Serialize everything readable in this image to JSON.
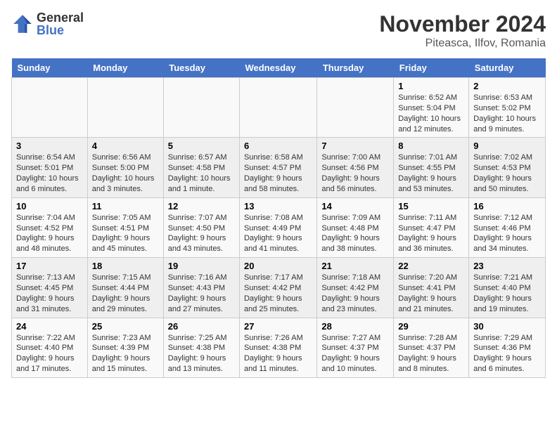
{
  "header": {
    "logo_general": "General",
    "logo_blue": "Blue",
    "month_title": "November 2024",
    "location": "Piteasca, Ilfov, Romania"
  },
  "weekdays": [
    "Sunday",
    "Monday",
    "Tuesday",
    "Wednesday",
    "Thursday",
    "Friday",
    "Saturday"
  ],
  "weeks": [
    [
      {
        "day": "",
        "info": ""
      },
      {
        "day": "",
        "info": ""
      },
      {
        "day": "",
        "info": ""
      },
      {
        "day": "",
        "info": ""
      },
      {
        "day": "",
        "info": ""
      },
      {
        "day": "1",
        "info": "Sunrise: 6:52 AM\nSunset: 5:04 PM\nDaylight: 10 hours and 12 minutes."
      },
      {
        "day": "2",
        "info": "Sunrise: 6:53 AM\nSunset: 5:02 PM\nDaylight: 10 hours and 9 minutes."
      }
    ],
    [
      {
        "day": "3",
        "info": "Sunrise: 6:54 AM\nSunset: 5:01 PM\nDaylight: 10 hours and 6 minutes."
      },
      {
        "day": "4",
        "info": "Sunrise: 6:56 AM\nSunset: 5:00 PM\nDaylight: 10 hours and 3 minutes."
      },
      {
        "day": "5",
        "info": "Sunrise: 6:57 AM\nSunset: 4:58 PM\nDaylight: 10 hours and 1 minute."
      },
      {
        "day": "6",
        "info": "Sunrise: 6:58 AM\nSunset: 4:57 PM\nDaylight: 9 hours and 58 minutes."
      },
      {
        "day": "7",
        "info": "Sunrise: 7:00 AM\nSunset: 4:56 PM\nDaylight: 9 hours and 56 minutes."
      },
      {
        "day": "8",
        "info": "Sunrise: 7:01 AM\nSunset: 4:55 PM\nDaylight: 9 hours and 53 minutes."
      },
      {
        "day": "9",
        "info": "Sunrise: 7:02 AM\nSunset: 4:53 PM\nDaylight: 9 hours and 50 minutes."
      }
    ],
    [
      {
        "day": "10",
        "info": "Sunrise: 7:04 AM\nSunset: 4:52 PM\nDaylight: 9 hours and 48 minutes."
      },
      {
        "day": "11",
        "info": "Sunrise: 7:05 AM\nSunset: 4:51 PM\nDaylight: 9 hours and 45 minutes."
      },
      {
        "day": "12",
        "info": "Sunrise: 7:07 AM\nSunset: 4:50 PM\nDaylight: 9 hours and 43 minutes."
      },
      {
        "day": "13",
        "info": "Sunrise: 7:08 AM\nSunset: 4:49 PM\nDaylight: 9 hours and 41 minutes."
      },
      {
        "day": "14",
        "info": "Sunrise: 7:09 AM\nSunset: 4:48 PM\nDaylight: 9 hours and 38 minutes."
      },
      {
        "day": "15",
        "info": "Sunrise: 7:11 AM\nSunset: 4:47 PM\nDaylight: 9 hours and 36 minutes."
      },
      {
        "day": "16",
        "info": "Sunrise: 7:12 AM\nSunset: 4:46 PM\nDaylight: 9 hours and 34 minutes."
      }
    ],
    [
      {
        "day": "17",
        "info": "Sunrise: 7:13 AM\nSunset: 4:45 PM\nDaylight: 9 hours and 31 minutes."
      },
      {
        "day": "18",
        "info": "Sunrise: 7:15 AM\nSunset: 4:44 PM\nDaylight: 9 hours and 29 minutes."
      },
      {
        "day": "19",
        "info": "Sunrise: 7:16 AM\nSunset: 4:43 PM\nDaylight: 9 hours and 27 minutes."
      },
      {
        "day": "20",
        "info": "Sunrise: 7:17 AM\nSunset: 4:42 PM\nDaylight: 9 hours and 25 minutes."
      },
      {
        "day": "21",
        "info": "Sunrise: 7:18 AM\nSunset: 4:42 PM\nDaylight: 9 hours and 23 minutes."
      },
      {
        "day": "22",
        "info": "Sunrise: 7:20 AM\nSunset: 4:41 PM\nDaylight: 9 hours and 21 minutes."
      },
      {
        "day": "23",
        "info": "Sunrise: 7:21 AM\nSunset: 4:40 PM\nDaylight: 9 hours and 19 minutes."
      }
    ],
    [
      {
        "day": "24",
        "info": "Sunrise: 7:22 AM\nSunset: 4:40 PM\nDaylight: 9 hours and 17 minutes."
      },
      {
        "day": "25",
        "info": "Sunrise: 7:23 AM\nSunset: 4:39 PM\nDaylight: 9 hours and 15 minutes."
      },
      {
        "day": "26",
        "info": "Sunrise: 7:25 AM\nSunset: 4:38 PM\nDaylight: 9 hours and 13 minutes."
      },
      {
        "day": "27",
        "info": "Sunrise: 7:26 AM\nSunset: 4:38 PM\nDaylight: 9 hours and 11 minutes."
      },
      {
        "day": "28",
        "info": "Sunrise: 7:27 AM\nSunset: 4:37 PM\nDaylight: 9 hours and 10 minutes."
      },
      {
        "day": "29",
        "info": "Sunrise: 7:28 AM\nSunset: 4:37 PM\nDaylight: 9 hours and 8 minutes."
      },
      {
        "day": "30",
        "info": "Sunrise: 7:29 AM\nSunset: 4:36 PM\nDaylight: 9 hours and 6 minutes."
      }
    ]
  ]
}
